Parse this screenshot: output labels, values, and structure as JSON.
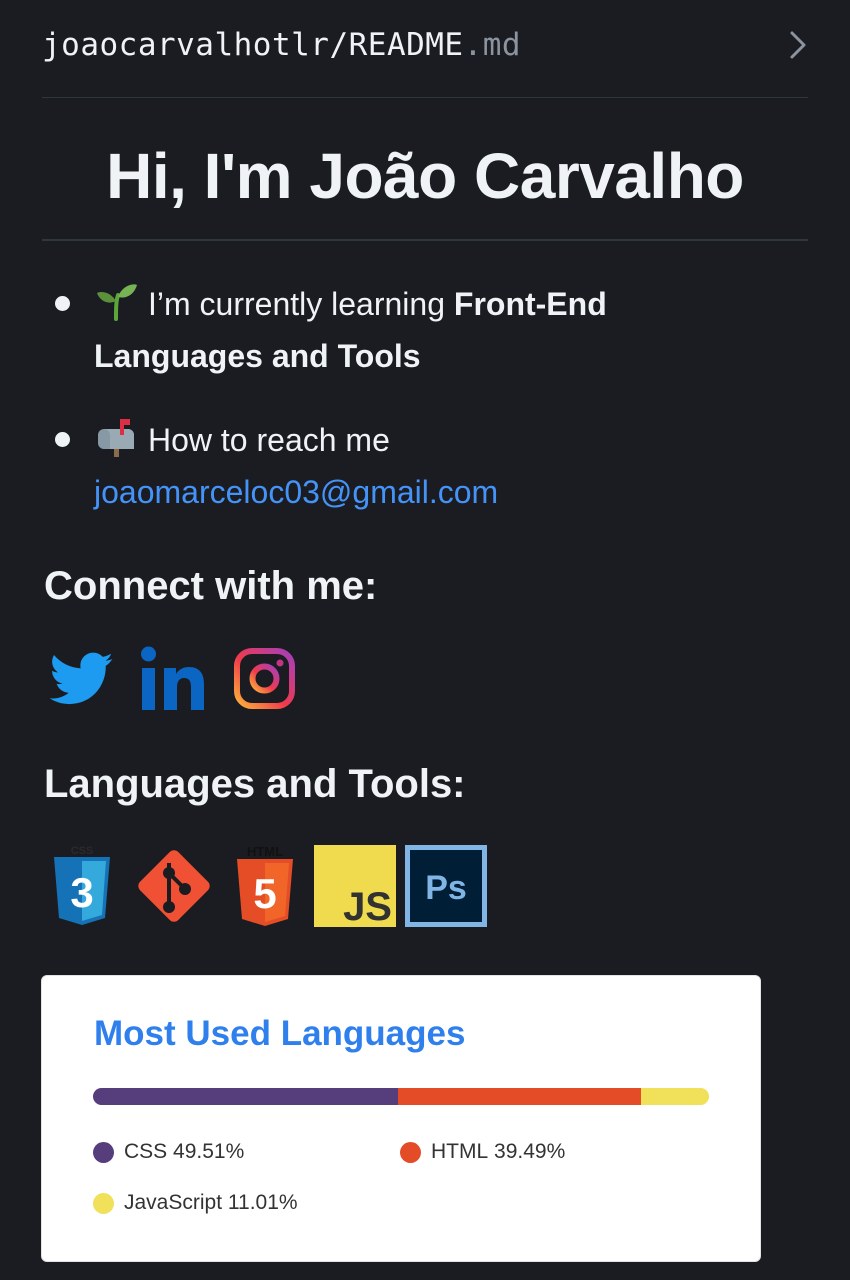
{
  "header": {
    "path": "joaocarvalhotlr/README",
    "ext": ".md"
  },
  "title": "Hi, I'm João Carvalho",
  "bullets": [
    {
      "text": "I’m currently learning ",
      "bold": "Front-End Languages and Tools"
    },
    {
      "text": "How to reach me ",
      "link": "joaomarceloc03@gmail.com"
    }
  ],
  "connect_heading": "Connect with me:",
  "social": [
    "twitter-icon",
    "linkedin-icon",
    "instagram-icon"
  ],
  "tools_heading": "Languages and Tools:",
  "tools": [
    {
      "icon": "css3-icon",
      "label": "CSS",
      "glyph": "3"
    },
    {
      "icon": "git-icon"
    },
    {
      "icon": "html5-icon",
      "label": "HTML",
      "glyph": "5"
    },
    {
      "icon": "javascript-icon",
      "glyph": "JS"
    },
    {
      "icon": "photoshop-icon",
      "glyph": "Ps"
    }
  ],
  "card": {
    "title": "Most Used Languages",
    "languages": [
      {
        "name": "CSS",
        "percent": 49.51,
        "label": "49.51%",
        "color": "#563d7c"
      },
      {
        "name": "HTML",
        "percent": 39.49,
        "label": "39.49%",
        "color": "#e34c26"
      },
      {
        "name": "JavaScript",
        "percent": 11.01,
        "label": "11.01%",
        "color": "#f1e05a"
      }
    ]
  }
}
